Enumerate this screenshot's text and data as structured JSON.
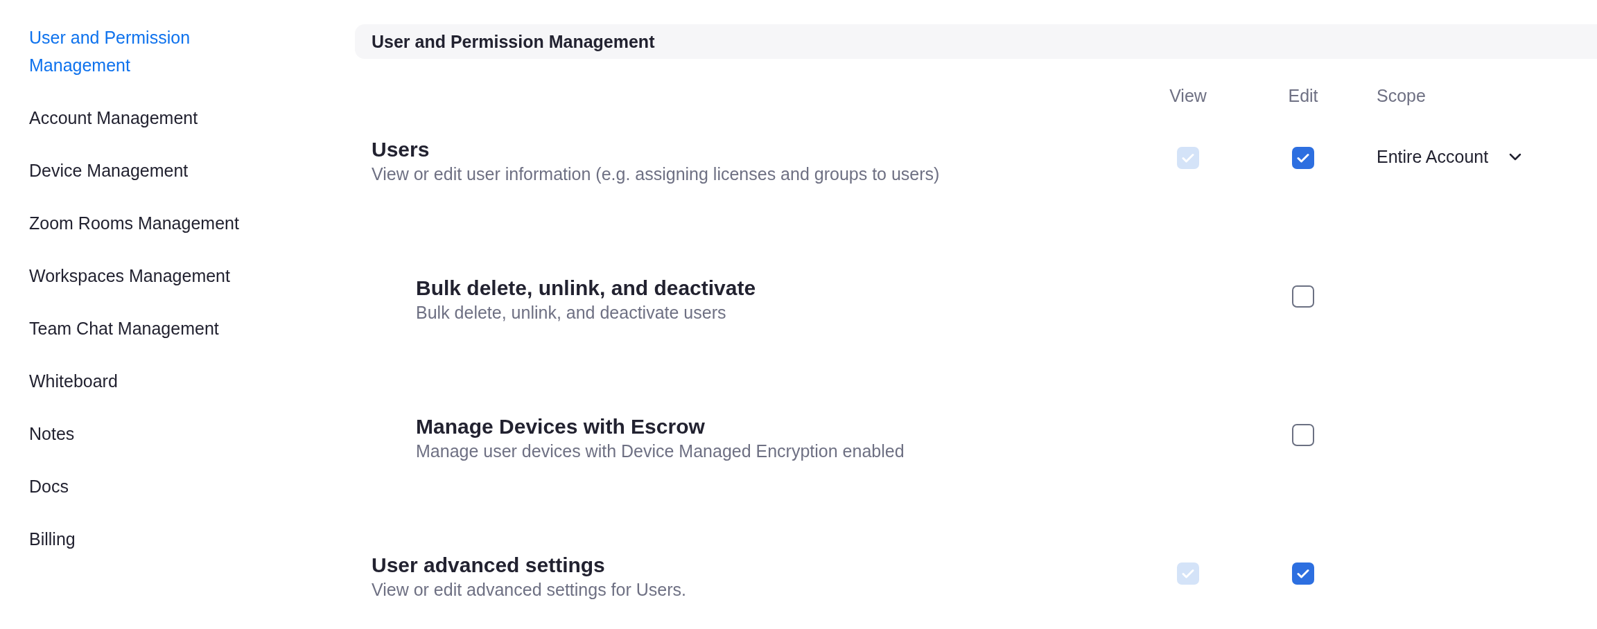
{
  "sidebar": {
    "items": [
      {
        "label": "User and Permission Management",
        "selected": true
      },
      {
        "label": "Account Management",
        "selected": false
      },
      {
        "label": "Device Management",
        "selected": false
      },
      {
        "label": "Zoom Rooms Management",
        "selected": false
      },
      {
        "label": "Workspaces Management",
        "selected": false
      },
      {
        "label": "Team Chat Management",
        "selected": false
      },
      {
        "label": "Whiteboard",
        "selected": false
      },
      {
        "label": "Notes",
        "selected": false
      },
      {
        "label": "Docs",
        "selected": false
      },
      {
        "label": "Billing",
        "selected": false
      }
    ]
  },
  "section": {
    "title": "User and Permission Management"
  },
  "columns": [
    "View",
    "Edit",
    "Scope"
  ],
  "permissions": [
    {
      "title": "Users",
      "description": "View or edit user information (e.g. assigning licenses and groups to users)",
      "view": {
        "checked": true,
        "disabled": true
      },
      "edit": {
        "checked": true
      },
      "scope": "Entire Account",
      "children": [
        {
          "title": "Bulk delete, unlink, and deactivate",
          "description": "Bulk delete, unlink, and deactivate users",
          "edit": {
            "checked": false
          }
        },
        {
          "title": "Manage Devices with Escrow",
          "description": "Manage user devices with Device Managed Encryption enabled",
          "edit": {
            "checked": false
          }
        }
      ]
    },
    {
      "title": "User advanced settings",
      "description": "View or edit advanced settings for Users.",
      "view": {
        "checked": true,
        "disabled": true
      },
      "edit": {
        "checked": true
      }
    }
  ]
}
